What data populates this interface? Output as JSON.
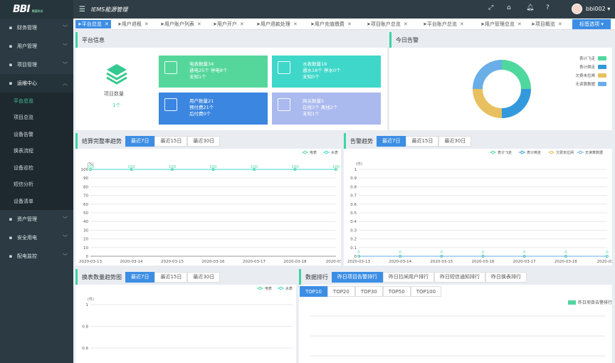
{
  "app": {
    "logo": "BBI",
    "logo_sub": "鼎基科技",
    "title": "IEMS能源管理",
    "user": "bbi002"
  },
  "sidebar": {
    "items": [
      {
        "label": "财务管理",
        "icon": "wallet-icon"
      },
      {
        "label": "用户管理",
        "icon": "user-icon"
      },
      {
        "label": "项目管理",
        "icon": "project-icon"
      },
      {
        "label": "运维中心",
        "icon": "gear-icon",
        "open": true
      },
      {
        "label": "资产管理",
        "icon": "asset-icon"
      },
      {
        "label": "安全用电",
        "icon": "shield-icon"
      },
      {
        "label": "配电监控",
        "icon": "monitor-icon"
      }
    ],
    "sub": [
      "平台总览",
      "项目总览",
      "设备告警",
      "换表流程",
      "设备巡检",
      "短信分析",
      "设备清单"
    ]
  },
  "tabs": [
    "平台总览",
    "用户退租",
    "用户账户列表",
    "用户开户",
    "用户退款处理",
    "用户充值缴费",
    "项目账户总览",
    "平台账户总览",
    "用户管理总览",
    "项目概览"
  ],
  "more_label": "标签选项",
  "platform": {
    "title": "平台信息",
    "project_label": "项目数量",
    "project_count": "1个",
    "tiles": [
      {
        "lines": [
          "电表数量34",
          "通电25个 停电8个",
          "未知1个"
        ],
        "color": "#55d79b",
        "icon": "meter-icon"
      },
      {
        "lines": [
          "水表数量18",
          "通水18个 停水0个",
          "未知0个"
        ],
        "color": "#3fd7c9",
        "icon": "water-meter-icon"
      },
      {
        "lines": [
          "用户数量21",
          "预付费21个",
          "后付费0个"
        ],
        "color": "#3b86e0",
        "icon": "person-icon"
      },
      {
        "lines": [
          "网关数量5",
          "在线3个 离线2个",
          "未知1个"
        ],
        "color": "#aab9ee",
        "icon": "gateway-icon"
      }
    ]
  },
  "alarm_today": {
    "title": "今日告警",
    "legend": [
      "表计飞走",
      "表计倒走",
      "欠费未拉闸",
      "无读算数据"
    ],
    "colors": [
      "#4fd89d",
      "#3399dd",
      "#e9c060",
      "#6aaee8"
    ]
  },
  "range_buttons": [
    "最近7日",
    "最近15日",
    "最近30日"
  ],
  "settle": {
    "title": "结算完整率趋势",
    "legend": [
      "电表",
      "水表"
    ],
    "unit": "(%)"
  },
  "alarm_trend": {
    "title": "告警趋势",
    "legend": [
      "表计飞走",
      "表计倒走",
      "欠费未拉闸",
      "无读算数据"
    ],
    "unit": "(件)"
  },
  "swap": {
    "title": "换表数量趋势图",
    "legend": [
      "电表",
      "水表"
    ],
    "unit": "(件)"
  },
  "rank": {
    "title": "数据排行",
    "tabs": [
      "昨日项目告警排行",
      "昨日拉闸用户排行",
      "昨日短信通知排行",
      "昨日换表排行"
    ],
    "tops": [
      "TOP10",
      "TOP20",
      "TOP30",
      "TOP50",
      "TOP100"
    ],
    "legend": "昨日项目告警排行"
  },
  "chart_data": [
    {
      "type": "line",
      "title": "结算完整率趋势",
      "ylabel": "(%)",
      "x": [
        "2020-03-13",
        "2020-03-14",
        "2020-03-15",
        "2020-03-16",
        "2020-03-17",
        "2020-03-18",
        "2020-03-1"
      ],
      "ylim": [
        0,
        100
      ],
      "yticks": [
        0,
        10,
        20,
        30,
        40,
        50,
        60,
        70,
        80,
        90,
        100
      ],
      "series": [
        {
          "name": "电表",
          "values": [
            100,
            100,
            100,
            100,
            100,
            100,
            100
          ]
        },
        {
          "name": "水表",
          "values": [
            100,
            100,
            100,
            100,
            100,
            100,
            100
          ]
        }
      ]
    },
    {
      "type": "line",
      "title": "告警趋势",
      "ylabel": "(件)",
      "x": [
        "2020-03-13",
        "2020-03-14",
        "2020-03-15",
        "2020-03-16",
        "2020-03-17",
        "2020-03-18",
        "2020-03-1"
      ],
      "ylim": [
        0,
        1
      ],
      "yticks": [
        0,
        0.1,
        0.2,
        0.3,
        0.4,
        0.5,
        0.6,
        0.7,
        0.8,
        0.9,
        1
      ],
      "series": [
        {
          "name": "表计飞走",
          "values": [
            0,
            0,
            0,
            0,
            0,
            0,
            0
          ]
        },
        {
          "name": "表计倒走",
          "values": [
            0,
            0,
            0,
            0,
            0,
            0,
            0
          ]
        },
        {
          "name": "欠费未拉闸",
          "values": [
            0,
            0,
            0,
            0,
            0,
            0,
            0
          ]
        },
        {
          "name": "无读算数据",
          "values": [
            0,
            0,
            0,
            0,
            0,
            0,
            0
          ]
        }
      ]
    },
    {
      "type": "line",
      "title": "换表数量趋势图",
      "ylabel": "(件)",
      "yticks": [
        0.6,
        0.8,
        1
      ]
    }
  ]
}
